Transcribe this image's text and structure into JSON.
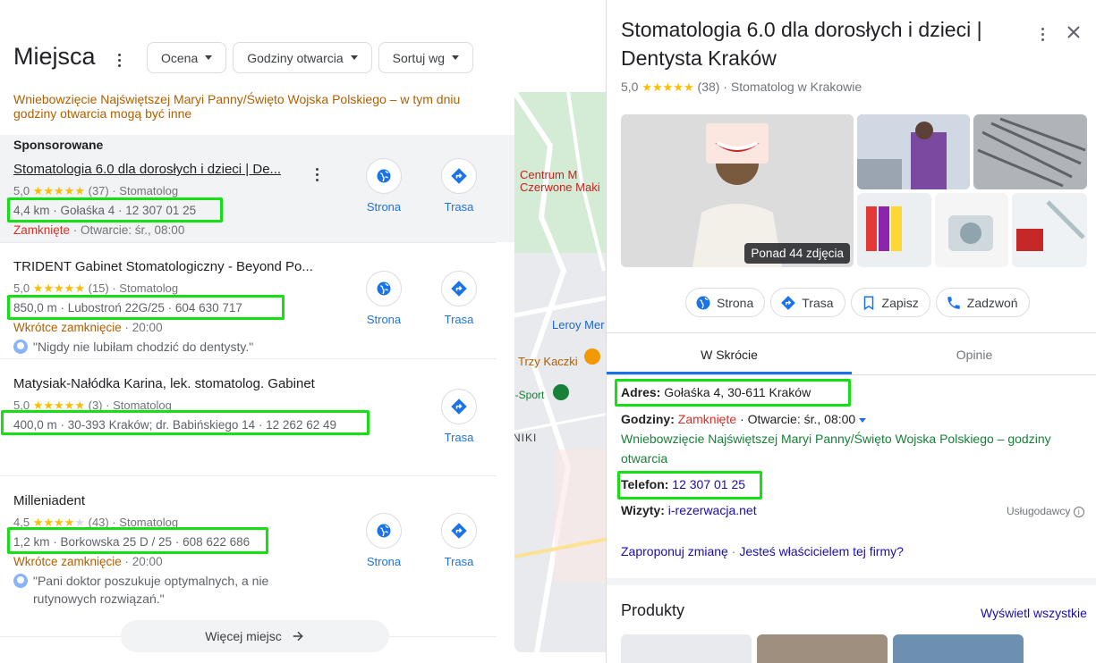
{
  "left": {
    "title": "Miejsca",
    "filters": [
      "Ocena",
      "Godziny otwarcia",
      "Sortuj wg"
    ],
    "holiday_notice": "Wniebowzięcie Najświętszej Maryi Panny/Święto Wojska Polskiego – w tym dniu godziny otwarcia mogą być inne",
    "sponsored_label": "Sponsorowane",
    "action_labels": {
      "website": "Strona",
      "directions": "Trasa"
    },
    "results": [
      {
        "name": "Stomatologia 6.0 dla dorosłych i dzieci | De...",
        "rating": "5,0",
        "reviews": "(37)",
        "category": "Stomatolog",
        "address_line": "4,4 km · Gołaśka 4 · 12 307 01 25",
        "status": "Zamknięte",
        "status_rest": " · Otwarcie: śr., 08:00"
      },
      {
        "name": "TRIDENT Gabinet Stomatologiczny - Beyond Po...",
        "rating": "5,0",
        "reviews": "(15)",
        "category": "Stomatolog",
        "address_line": "850,0 m · Lubostroń 22G/25 · 604 630 717",
        "status": "Wkrótce zamknięcie",
        "status_rest": " · 20:00",
        "review": "\"Nigdy nie lubiłam chodzić do dentysty.\""
      },
      {
        "name": "Matysiak-Nałódka Karina, lek. stomatolog. Gabinet",
        "rating": "5,0",
        "reviews": "(3)",
        "category": "Stomatolog",
        "address_line": "400,0 m · 30-393 Kraków; dr. Babińskiego 14 · 12 262 62 49"
      },
      {
        "name": "Milleniadent",
        "rating": "4,5",
        "reviews": "(43)",
        "category": "Stomatolog",
        "address_line": "1,2 km · Borkowska 25 D / 25 · 608 622 686",
        "status": "Wkrótce zamknięcie",
        "status_rest": " · 20:00",
        "review": "\"Pani doktor poszukuje optymalnych, a nie rutynowych rozwiązań.\""
      }
    ],
    "more_places": "Więcej miejsc"
  },
  "map": {
    "labels": [
      "Centrum M",
      "Czerwone Maki",
      "Leroy Mer",
      "Trzy Kaczki",
      "i-Sport",
      "NIKI"
    ]
  },
  "panel": {
    "title": "Stomatologia 6.0 dla dorosłych i dzieci | Dentysta Kraków",
    "rating": "5,0",
    "reviews": "(38)",
    "category": "Stomatolog w Krakowie",
    "photo_count": "Ponad 44 zdjęcia",
    "actions": [
      "Strona",
      "Trasa",
      "Zapisz",
      "Zadzwoń"
    ],
    "tabs": [
      "W Skrócie",
      "Opinie"
    ],
    "address_label": "Adres:",
    "address": "Gołaśka 4, 30-611 Kraków",
    "hours_label": "Godziny:",
    "hours_status": "Zamknięte",
    "hours_rest": " · Otwarcie: śr., 08:00",
    "holiday": "Wniebowzięcie Najświętszej Maryi Panny/Święto Wojska Polskiego – godziny otwarcia",
    "phone_label": "Telefon:",
    "phone": "12 307 01 25",
    "visits_label": "Wizyty:",
    "visits": "i-rezerwacja.net",
    "provider": "Usługodawcy",
    "suggest": "Zaproponuj zmianę",
    "owner": "Jesteś właścicielem tej firmy?",
    "products_title": "Produkty",
    "products_all": "Wyświetl wszystkie"
  },
  "colors": {
    "accent": "#1a73e8",
    "highlight": "#14e014",
    "star": "#fbbc04",
    "closed": "#d93025",
    "warning": "#b06000"
  }
}
